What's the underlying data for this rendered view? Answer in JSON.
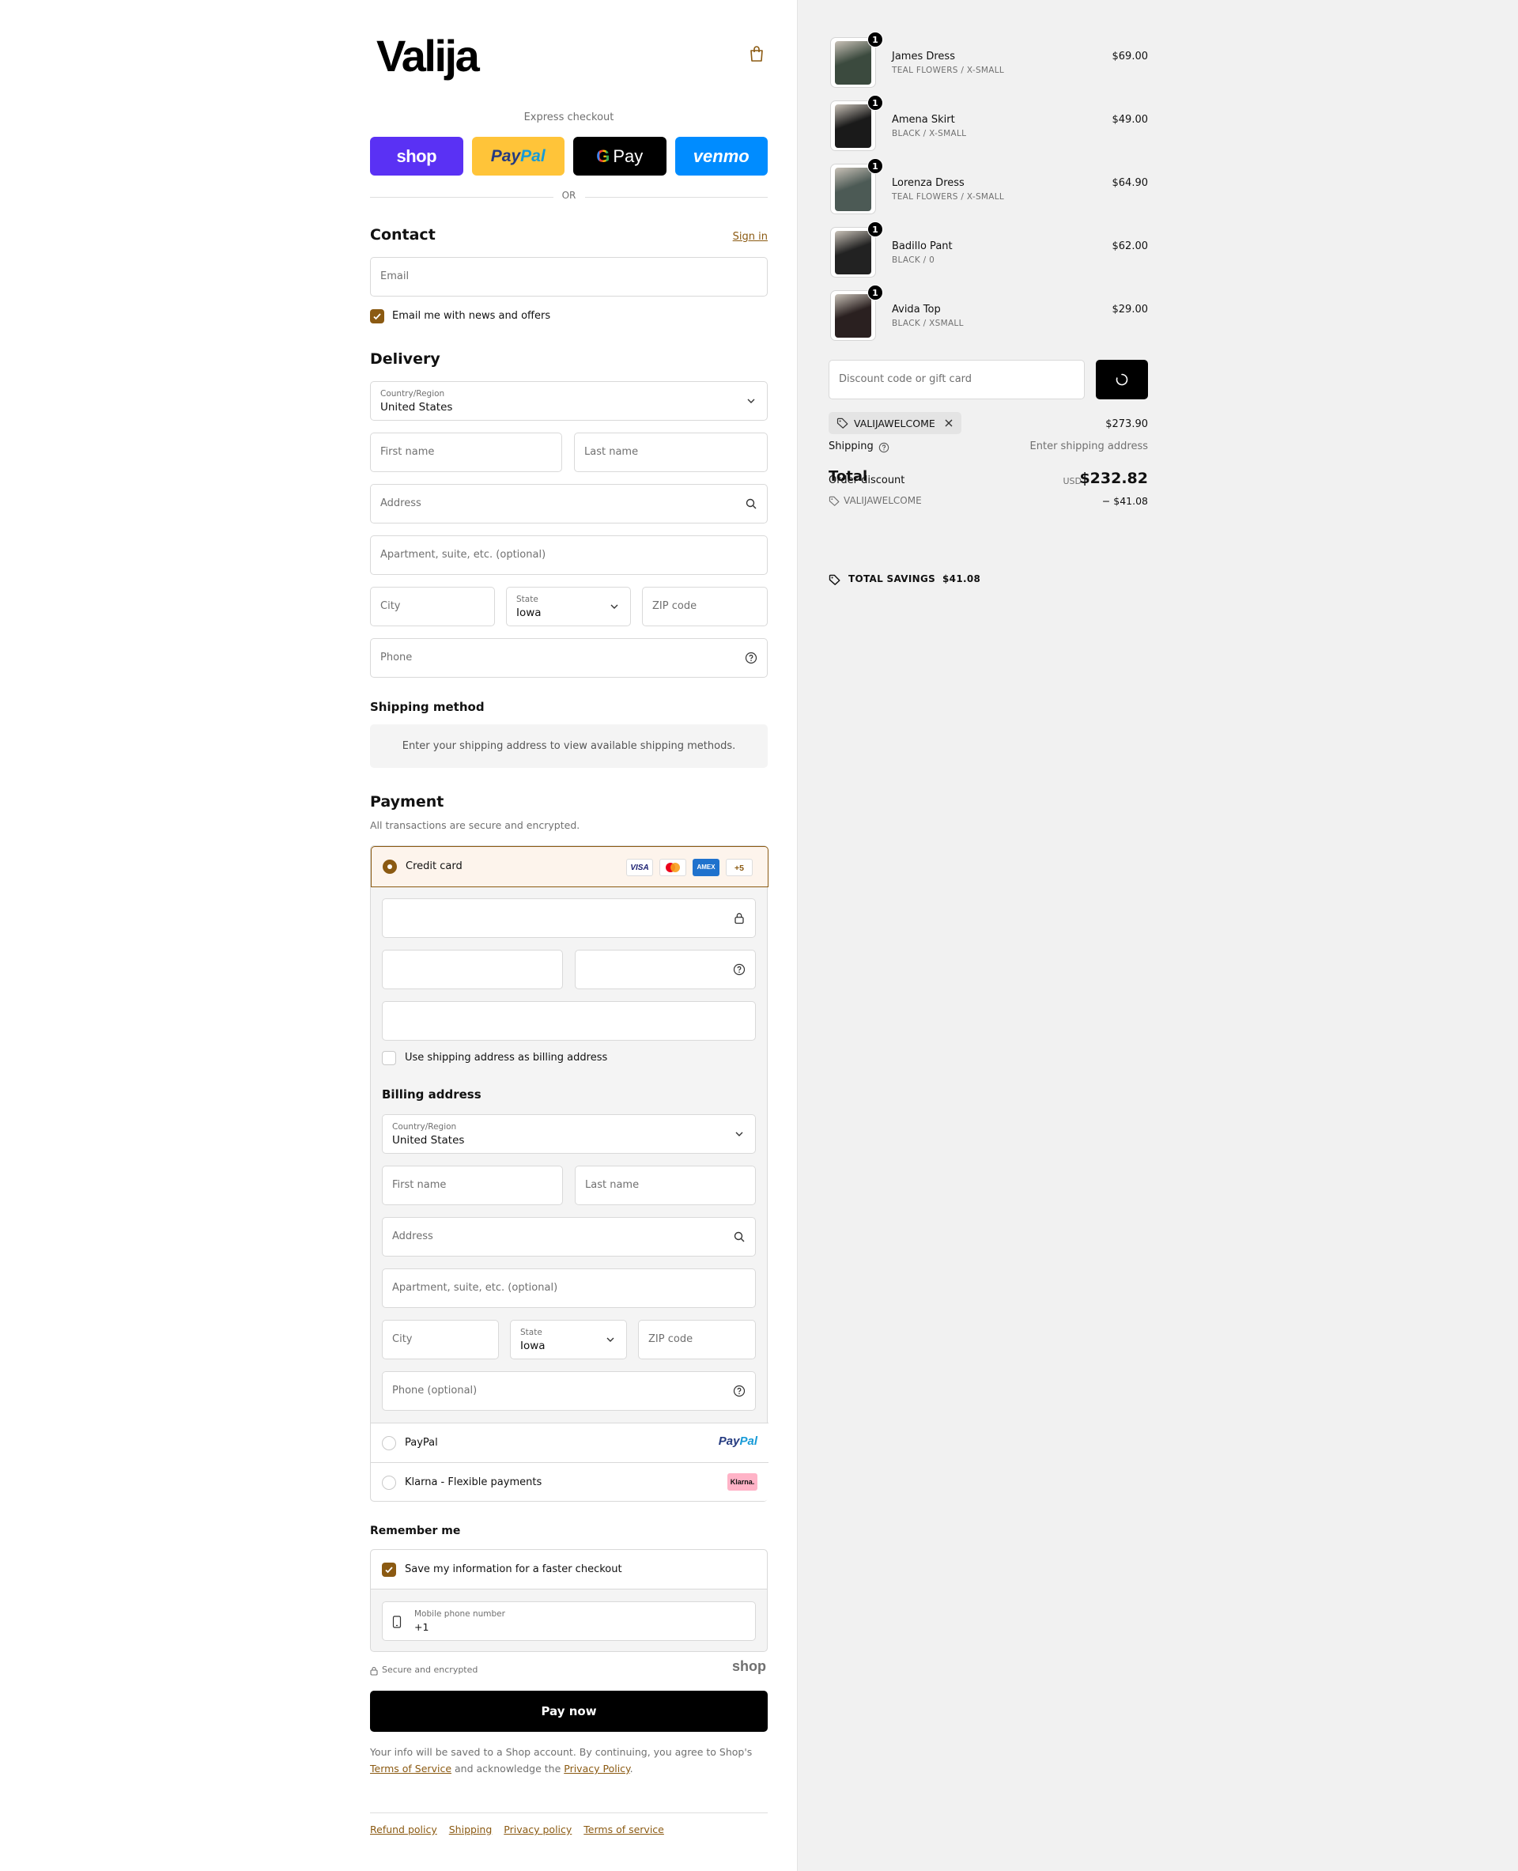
{
  "brand": {
    "logo_text": "Valija",
    "accent": "#8b5a12"
  },
  "express": {
    "label": "Express checkout",
    "shop": "shop",
    "paypal_a": "Pay",
    "paypal_b": "Pal",
    "gpay_g": "G",
    "gpay": "Pay",
    "venmo": "venmo",
    "or": "OR"
  },
  "contact": {
    "title": "Contact",
    "sign_in": "Sign in",
    "email_placeholder": "Email",
    "news_label": "Email me with news and offers"
  },
  "delivery": {
    "title": "Delivery",
    "country_label": "Country/Region",
    "country_value": "United States",
    "first_name": "First name",
    "last_name": "Last name",
    "address": "Address",
    "apartment": "Apartment, suite, etc. (optional)",
    "city": "City",
    "state_label": "State",
    "state_value": "Iowa",
    "zip": "ZIP code",
    "phone": "Phone"
  },
  "shipping_method": {
    "title": "Shipping method",
    "notice": "Enter your shipping address to view available shipping methods."
  },
  "payment": {
    "title": "Payment",
    "subtitle": "All transactions are secure and encrypted.",
    "credit_card": "Credit card",
    "cards": [
      "VISA",
      "",
      "AMEX",
      "+5"
    ],
    "use_shipping": "Use shipping address as billing address",
    "billing_title": "Billing address",
    "billing": {
      "country_label": "Country/Region",
      "country_value": "United States",
      "first_name": "First name",
      "last_name": "Last name",
      "address": "Address",
      "apartment": "Apartment, suite, etc. (optional)",
      "city": "City",
      "state_label": "State",
      "state_value": "Iowa",
      "zip": "ZIP code",
      "phone": "Phone (optional)"
    },
    "paypal": "PayPal",
    "paypal_logo_a": "Pay",
    "paypal_logo_b": "Pal",
    "klarna": "Klarna - Flexible payments",
    "klarna_logo": "Klarna."
  },
  "remember": {
    "title": "Remember me",
    "save_label": "Save my information for a faster checkout",
    "mobile_label": "Mobile phone number",
    "mobile_value": "+1",
    "secure": "Secure and encrypted",
    "shop": "shop"
  },
  "pay_now": "Pay now",
  "legal": {
    "text": "Your info will be saved to a Shop account. By continuing, you agree to Shop's",
    "terms": "Terms of Service",
    "and": "and acknowledge the",
    "privacy": "Privacy Policy",
    "end": "."
  },
  "footer": [
    "Refund policy",
    "Shipping",
    "Privacy policy",
    "Terms of service"
  ],
  "cart": {
    "items": [
      {
        "qty": "1",
        "name": "James Dress",
        "variant": "TEAL FLOWERS / X-SMALL",
        "price": "$69.00",
        "color": "#3b4a3e"
      },
      {
        "qty": "1",
        "name": "Amena Skirt",
        "variant": "BLACK / X-SMALL",
        "price": "$49.00",
        "color": "#1a1a1a"
      },
      {
        "qty": "1",
        "name": "Lorenza Dress",
        "variant": "TEAL FLOWERS / X-SMALL",
        "price": "$64.90",
        "color": "#4c5a55"
      },
      {
        "qty": "1",
        "name": "Badillo Pant",
        "variant": "BLACK / 0",
        "price": "$62.00",
        "color": "#222222"
      },
      {
        "qty": "1",
        "name": "Avida Top",
        "variant": "BLACK / XSMALL",
        "price": "$29.00",
        "color": "#2a2020"
      }
    ],
    "discount_placeholder": "Discount code or gift card",
    "applied_code": "VALIJAWELCOME",
    "subtotal": "$273.90",
    "shipping_label": "Shipping",
    "shipping_value": "Enter shipping address",
    "total_label": "Total",
    "currency": "USD",
    "total_value": "$232.82",
    "order_discount_label": "Order discount",
    "order_discount_code": "VALIJAWELCOME",
    "order_discount_value": "− $41.08",
    "savings_label": "TOTAL SAVINGS",
    "savings_value": "$41.08"
  }
}
